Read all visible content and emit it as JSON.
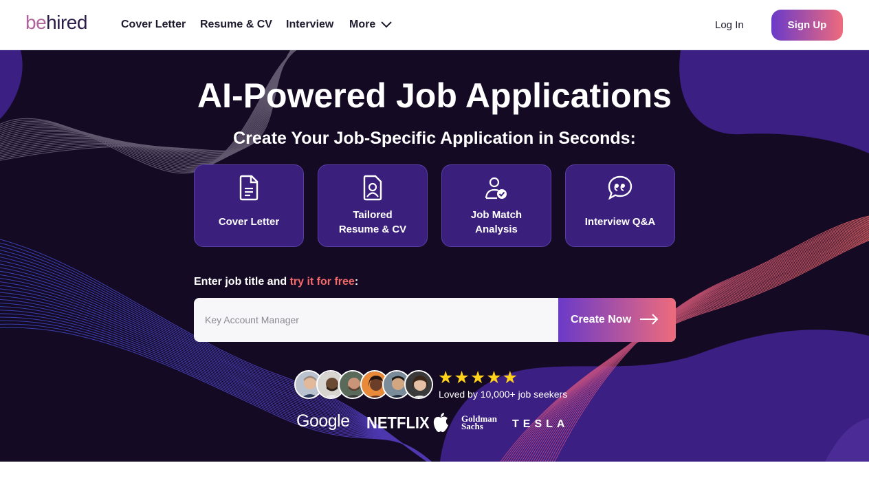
{
  "brand": {
    "logo_be": "be",
    "logo_hired": "hired"
  },
  "nav": {
    "links": [
      "Cover Letter",
      "Resume & CV",
      "Interview",
      "More"
    ],
    "login": "Log In",
    "signup": "Sign Up"
  },
  "hero": {
    "title": "AI-Powered Job Applications",
    "subtitle": "Create Your Job-Specific Application in Seconds:",
    "cards": [
      {
        "line1": "Cover Letter",
        "line2": "",
        "icon": "document-icon"
      },
      {
        "line1": "Tailored",
        "line2": "Resume & CV",
        "icon": "resume-icon"
      },
      {
        "line1": "Job Match",
        "line2": "Analysis",
        "icon": "user-check-icon"
      },
      {
        "line1": "Interview Q&A",
        "line2": "",
        "icon": "speech-bubble-icon"
      }
    ],
    "prompt_prefix": "Enter job title and ",
    "prompt_accent": "try it for free",
    "prompt_suffix": ":",
    "search_placeholder": "Key Account Manager",
    "create_button": "Create Now",
    "rating_stars": 5,
    "social_proof": "Loved by 10,000+ job seekers",
    "logos": [
      "Google",
      "NETFLIX",
      "apple-logo-icon",
      "Goldman Sachs",
      "TESLA"
    ]
  },
  "colors": {
    "hero_bg": "#150a24",
    "card_bg": "#3a1f7c",
    "accent_purple": "#6a3ac8",
    "accent_coral": "#ee6b7c",
    "star": "#ffd21c"
  }
}
